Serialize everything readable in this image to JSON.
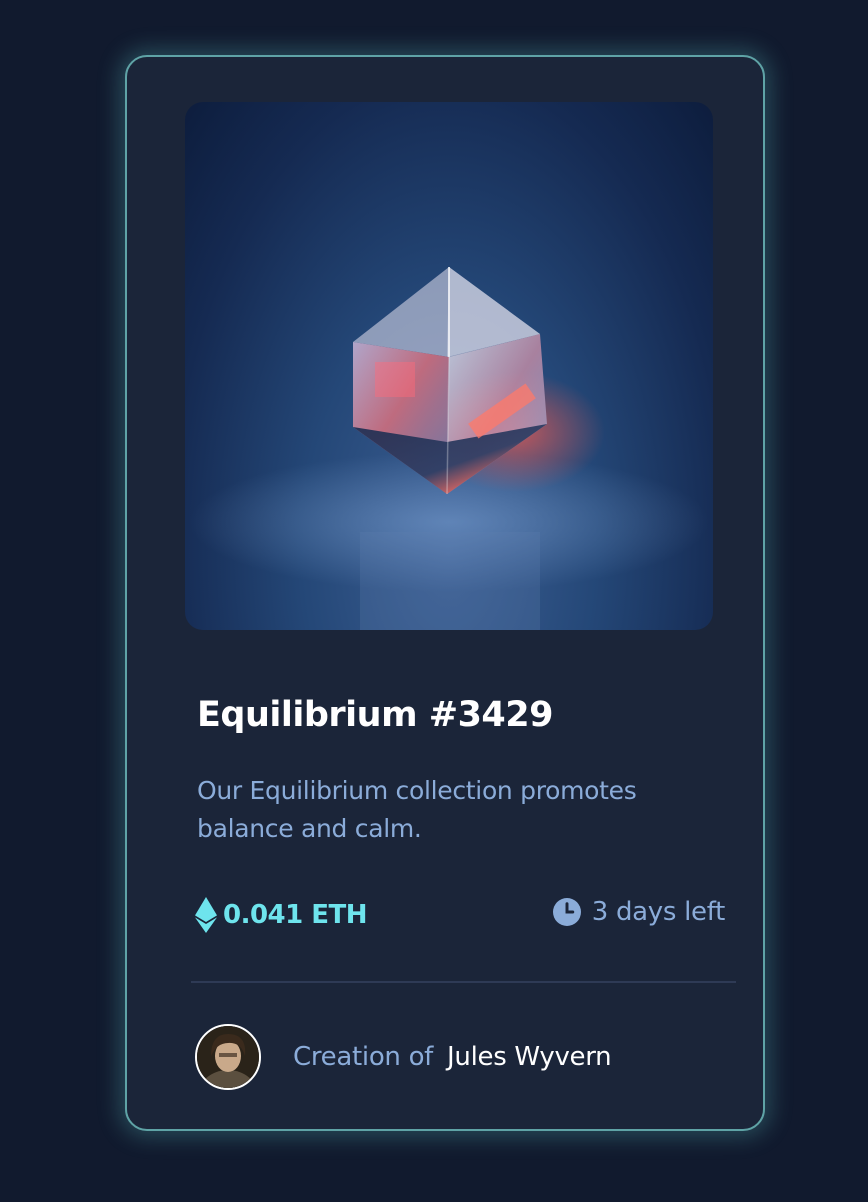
{
  "card": {
    "title": "Equilibrium #3429",
    "description": "Our Equilibrium collection promotes balance and calm.",
    "price": "0.041 ETH",
    "time_left": "3 days left",
    "creator_label": "Creation of",
    "creator_name": "Jules Wyvern"
  },
  "icons": {
    "price": "ethereum-icon",
    "time": "clock-icon"
  },
  "colors": {
    "background": "#111a2e",
    "card": "#1b2539",
    "accent": "#6ee4ed",
    "muted_text": "#8bacd9",
    "title": "#ffffff"
  }
}
